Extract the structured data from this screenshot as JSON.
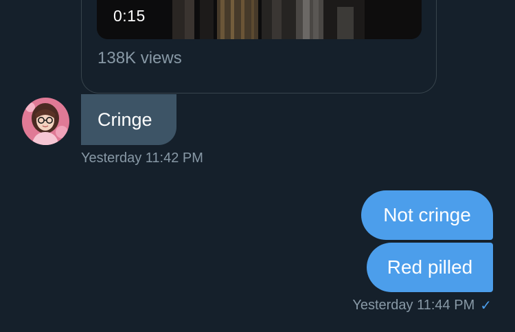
{
  "shared_video": {
    "duration": "0:15",
    "views": "138K views"
  },
  "received": {
    "message": "Cringe",
    "timestamp": "Yesterday 11:42 PM"
  },
  "sent": {
    "messages": [
      "Not cringe",
      "Red pilled"
    ],
    "timestamp": "Yesterday 11:44 PM",
    "status_icon": "checkmark-icon"
  },
  "colors": {
    "background": "#15202b",
    "received_bubble": "#3d5466",
    "sent_bubble": "#4c9eeb",
    "muted_text": "#8899a6"
  }
}
